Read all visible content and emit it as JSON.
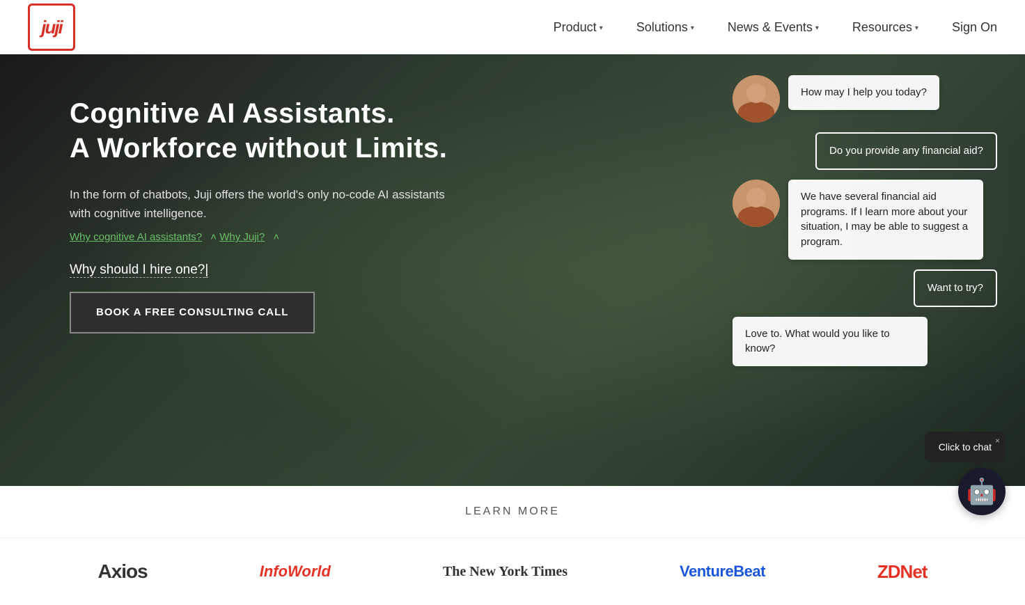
{
  "header": {
    "logo_text": "juji",
    "nav": [
      {
        "label": "Product",
        "has_caret": true
      },
      {
        "label": "Solutions",
        "has_caret": true
      },
      {
        "label": "News & Events",
        "has_caret": true
      },
      {
        "label": "Resources",
        "has_caret": true
      }
    ],
    "sign_on": "Sign On"
  },
  "hero": {
    "title_line1": "Cognitive AI Assistants.",
    "title_line2": "A Workforce without Limits.",
    "body": "In the form of chatbots, Juji offers the world's only no-code AI assistants with cognitive intelligence.",
    "links": [
      {
        "text": "Why cognitive AI assistants?"
      },
      {
        "text": "Why Juji?"
      }
    ],
    "question": "Why should I hire one?",
    "cta_button": "BOOK A FREE CONSULTING CALL"
  },
  "chat": {
    "messages": [
      {
        "type": "bot",
        "text": "How may I help you today?"
      },
      {
        "type": "user",
        "text": "Do you provide any financial aid?"
      },
      {
        "type": "bot",
        "text": "We have several financial aid programs. If I learn more about your situation, I may be able to suggest a program."
      },
      {
        "type": "user",
        "text": "Want to try?"
      },
      {
        "type": "bot",
        "text": "Love to. What would you like to know?"
      }
    ]
  },
  "learn_more": {
    "label": "LEARN MORE"
  },
  "logos": [
    {
      "name": "Axios",
      "style": "axios"
    },
    {
      "name": "InfoWorld",
      "style": "infoworld"
    },
    {
      "name": "The New York Times",
      "style": "nyt"
    },
    {
      "name": "VentureBeat",
      "style": "venturebeat"
    },
    {
      "name": "ZDNet",
      "style": "zdnet"
    }
  ],
  "chat_widget": {
    "popup_text": "Click to chat",
    "close_icon": "×"
  }
}
